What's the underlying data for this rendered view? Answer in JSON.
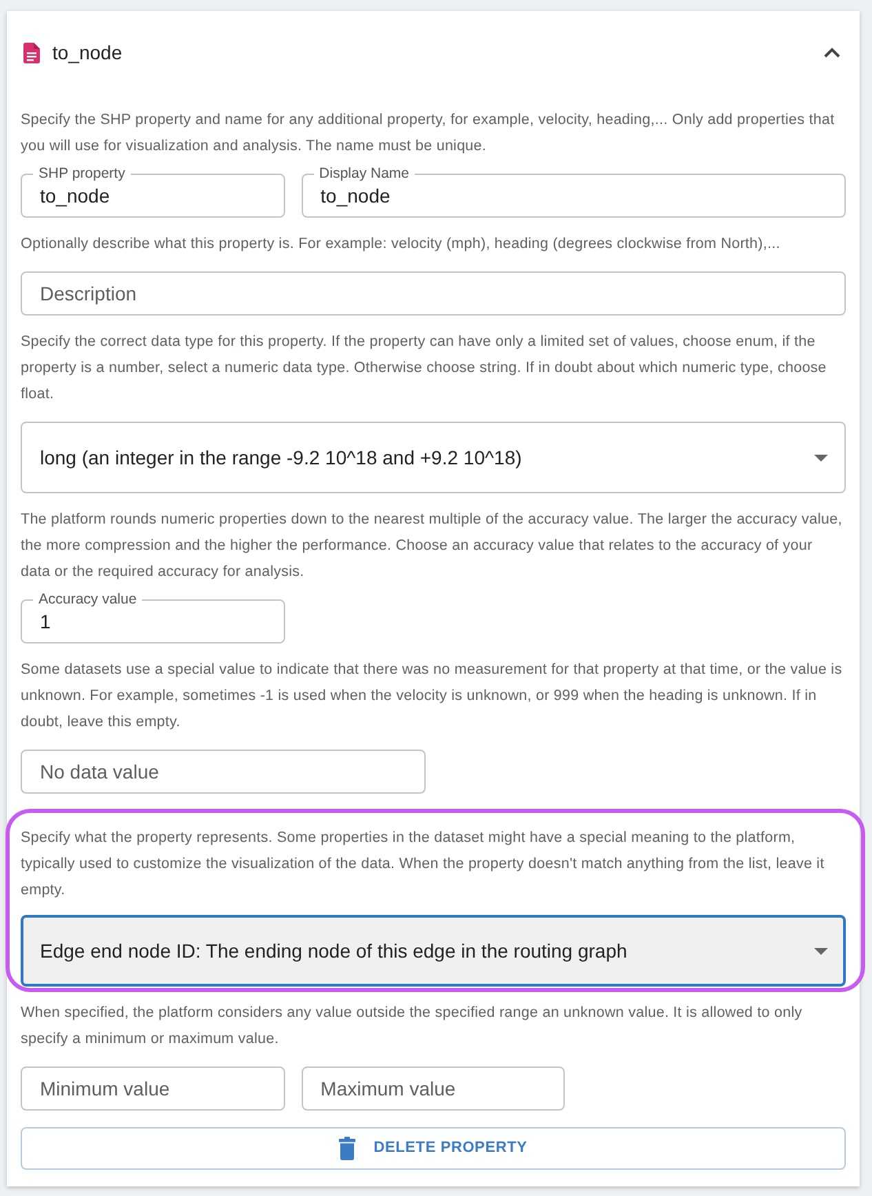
{
  "panel": {
    "title": "to_node",
    "expanded": true
  },
  "sections": [
    {
      "help": "Specify the SHP property and name for any additional property, for example, velocity, heading,... Only add properties that you will use for visualization and analysis. The name must be unique.",
      "highlighted": false,
      "fields": [
        {
          "kind": "text",
          "label": "SHP property",
          "value": "to_node"
        },
        {
          "kind": "text",
          "label": "Display Name",
          "value": "to_node"
        }
      ]
    },
    {
      "help": "Optionally describe what this property is. For example: velocity (mph), heading (degrees clockwise from North),...",
      "highlighted": false,
      "fields": [
        {
          "kind": "text",
          "placeholder": "Description"
        }
      ]
    },
    {
      "help": "Specify the correct data type for this property. If the property can have only a limited set of values, choose enum, if the property is a number, select a numeric data type. Otherwise choose string. If in doubt about which numeric type, choose float.",
      "highlighted": false,
      "fields": [
        {
          "kind": "select",
          "value": "long (an integer in the range -9.2 10^18 and +9.2 10^18)",
          "focused": false
        }
      ]
    },
    {
      "help": "The platform rounds numeric properties down to the nearest multiple of the accuracy value. The larger the accuracy value, the more compression and the higher the performance. Choose an accuracy value that relates to the accuracy of your data or the required accuracy for analysis.",
      "highlighted": false,
      "fields": [
        {
          "kind": "text",
          "label": "Accuracy value",
          "value": "1"
        }
      ]
    },
    {
      "help": "Some datasets use a special value to indicate that there was no measurement for that property at that time, or the value is unknown. For example, sometimes -1 is used when the velocity is unknown, or 999 when the heading is unknown. If in doubt, leave this empty.",
      "highlighted": false,
      "fields": [
        {
          "kind": "text",
          "placeholder": "No data value"
        }
      ]
    },
    {
      "help": "Specify what the property represents. Some properties in the dataset might have a special meaning to the platform, typically used to customize the visualization of the data. When the property doesn't match anything from the list, leave it empty.",
      "highlighted": true,
      "fields": [
        {
          "kind": "select",
          "value": "Edge end node ID: The ending node of this edge in the routing graph",
          "focused": true
        }
      ]
    },
    {
      "help": "When specified, the platform considers any value outside the specified range an unknown value. It is allowed to only specify a minimum or maximum value.",
      "highlighted": false,
      "fields": [
        {
          "kind": "text",
          "placeholder": "Minimum value"
        },
        {
          "kind": "text",
          "placeholder": "Maximum value"
        }
      ]
    }
  ],
  "delete_button": {
    "label": "DELETE PROPERTY"
  }
}
